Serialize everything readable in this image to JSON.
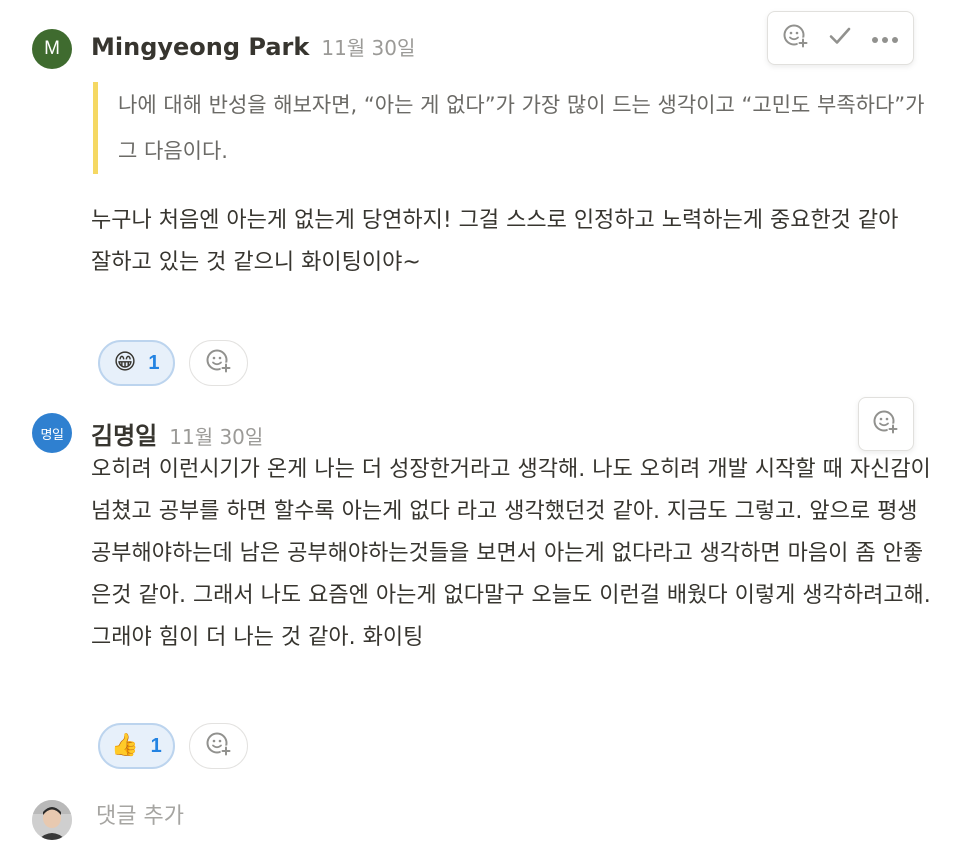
{
  "comments": [
    {
      "avatar_initial": "M",
      "author": "Mingyeong Park",
      "time": "11월 30일",
      "quote": "나에 대해 반성을 해보자면, “아는 게 없다”가 가장 많이 드는 생각이고 “고민도 부족하다”가 그 다음이다.",
      "body": "누구나 처음엔 아는게 없는게 당연하지! 그걸 스스로 인정하고 노력하는게 중요한것 같아\n잘하고 있는 것 같으니 화이팅이야~",
      "reaction": {
        "emoji": "😁",
        "count": "1"
      },
      "actions": [
        "add-reaction-icon",
        "resolve-check-icon",
        "more-icon"
      ]
    },
    {
      "avatar_initial": "명일",
      "author": "김명일",
      "time": "11월 30일",
      "body": "오히려 이런시기가 온게 나는 더 성장한거라고 생각해. 나도 오히려 개발 시작할 때 자신감이 넘쳤고 공부를 하면 할수록 아는게 없다 라고 생각했던것 같아. 지금도 그렇고. 앞으로 평생 공부해야하는데 남은 공부해야하는것들을 보면서 아는게 없다라고 생각하면 마음이 좀 안좋은것 같아. 그래서 나도 요즘엔 아는게 없다말구 오늘도 이런걸 배웠다 이렇게 생각하려고해. 그래야 힘이 더 나는 것 같아. 화이팅",
      "reaction": {
        "emoji": "👍",
        "count": "1"
      },
      "actions": [
        "add-reaction-icon"
      ]
    }
  ],
  "add_comment": {
    "placeholder": "댓글 추가"
  },
  "colors": {
    "accent": "#2383e2",
    "quote_bar": "#f5d863",
    "avatar_m": "#3f6b2f",
    "avatar_k": "#2f80d0"
  }
}
